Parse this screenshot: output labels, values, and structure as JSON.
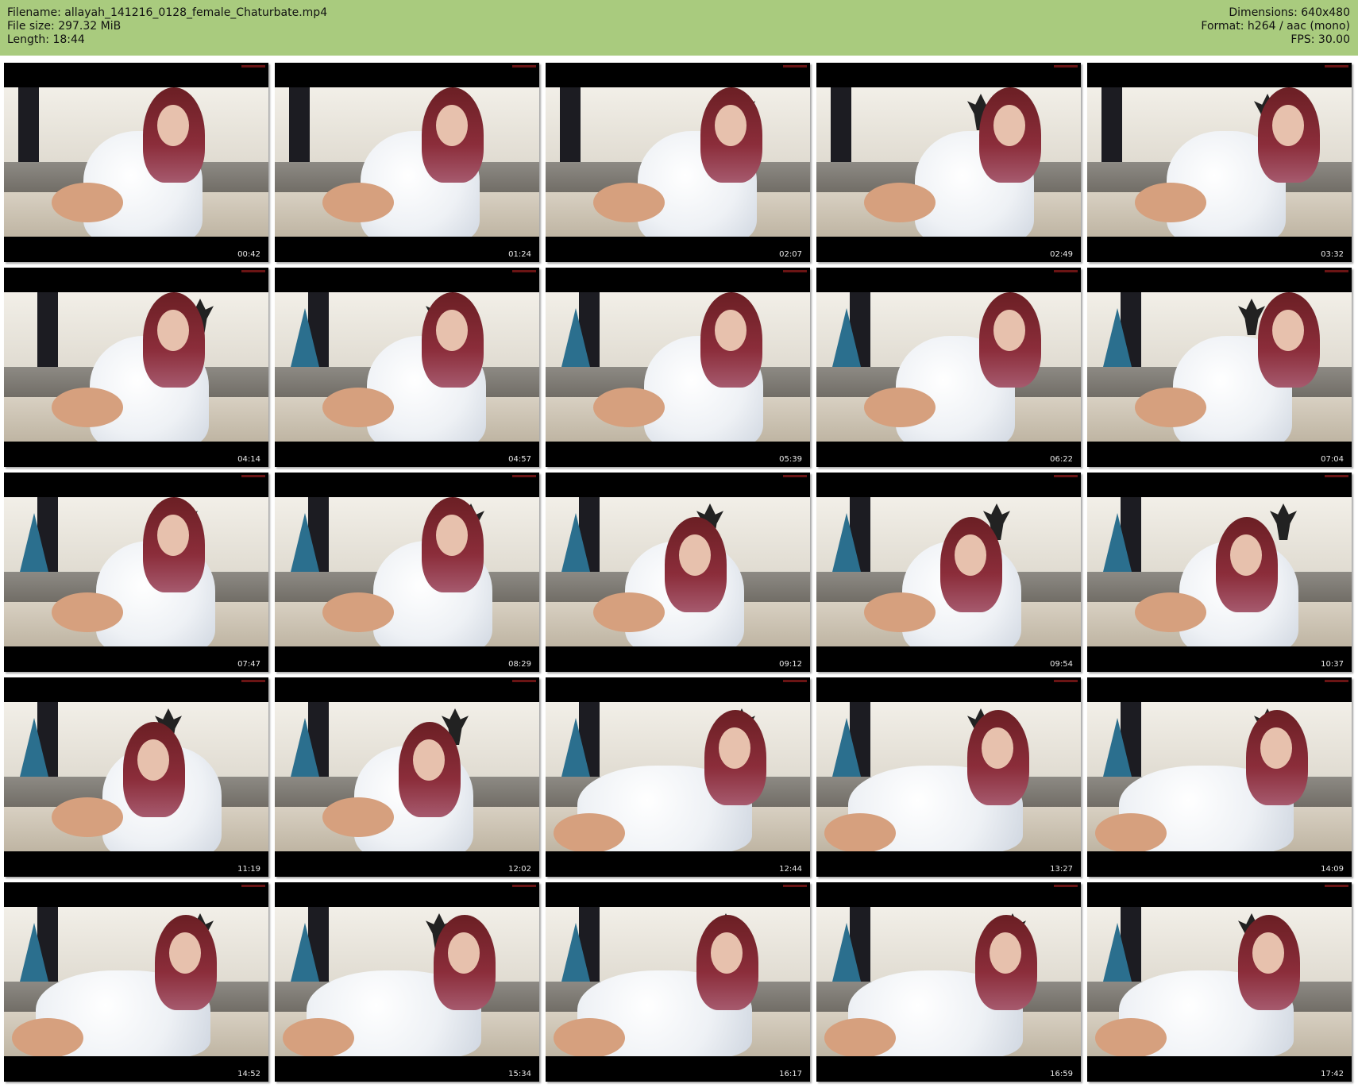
{
  "header": {
    "filename": "Filename: allayah_141216_0128_female_Chaturbate.mp4",
    "filesize": "File size: 297.32 MiB",
    "length": "Length: 18:44",
    "dimensions": "Dimensions: 640x480",
    "format": "Format: h264 / aac (mono)",
    "fps": "FPS: 30.00"
  },
  "colors": {
    "header_bg": "#a9cb7e",
    "thumb_bg": "#000000"
  },
  "thumbnails": [
    {
      "time": "00:42"
    },
    {
      "time": "01:24"
    },
    {
      "time": "02:07"
    },
    {
      "time": "02:49"
    },
    {
      "time": "03:32"
    },
    {
      "time": "04:14"
    },
    {
      "time": "04:57"
    },
    {
      "time": "05:39"
    },
    {
      "time": "06:22"
    },
    {
      "time": "07:04"
    },
    {
      "time": "07:47"
    },
    {
      "time": "08:29"
    },
    {
      "time": "09:12"
    },
    {
      "time": "09:54"
    },
    {
      "time": "10:37"
    },
    {
      "time": "11:19"
    },
    {
      "time": "12:02"
    },
    {
      "time": "12:44"
    },
    {
      "time": "13:27"
    },
    {
      "time": "14:09"
    },
    {
      "time": "14:52"
    },
    {
      "time": "15:34"
    },
    {
      "time": "16:17"
    },
    {
      "time": "16:59"
    },
    {
      "time": "17:42"
    }
  ]
}
